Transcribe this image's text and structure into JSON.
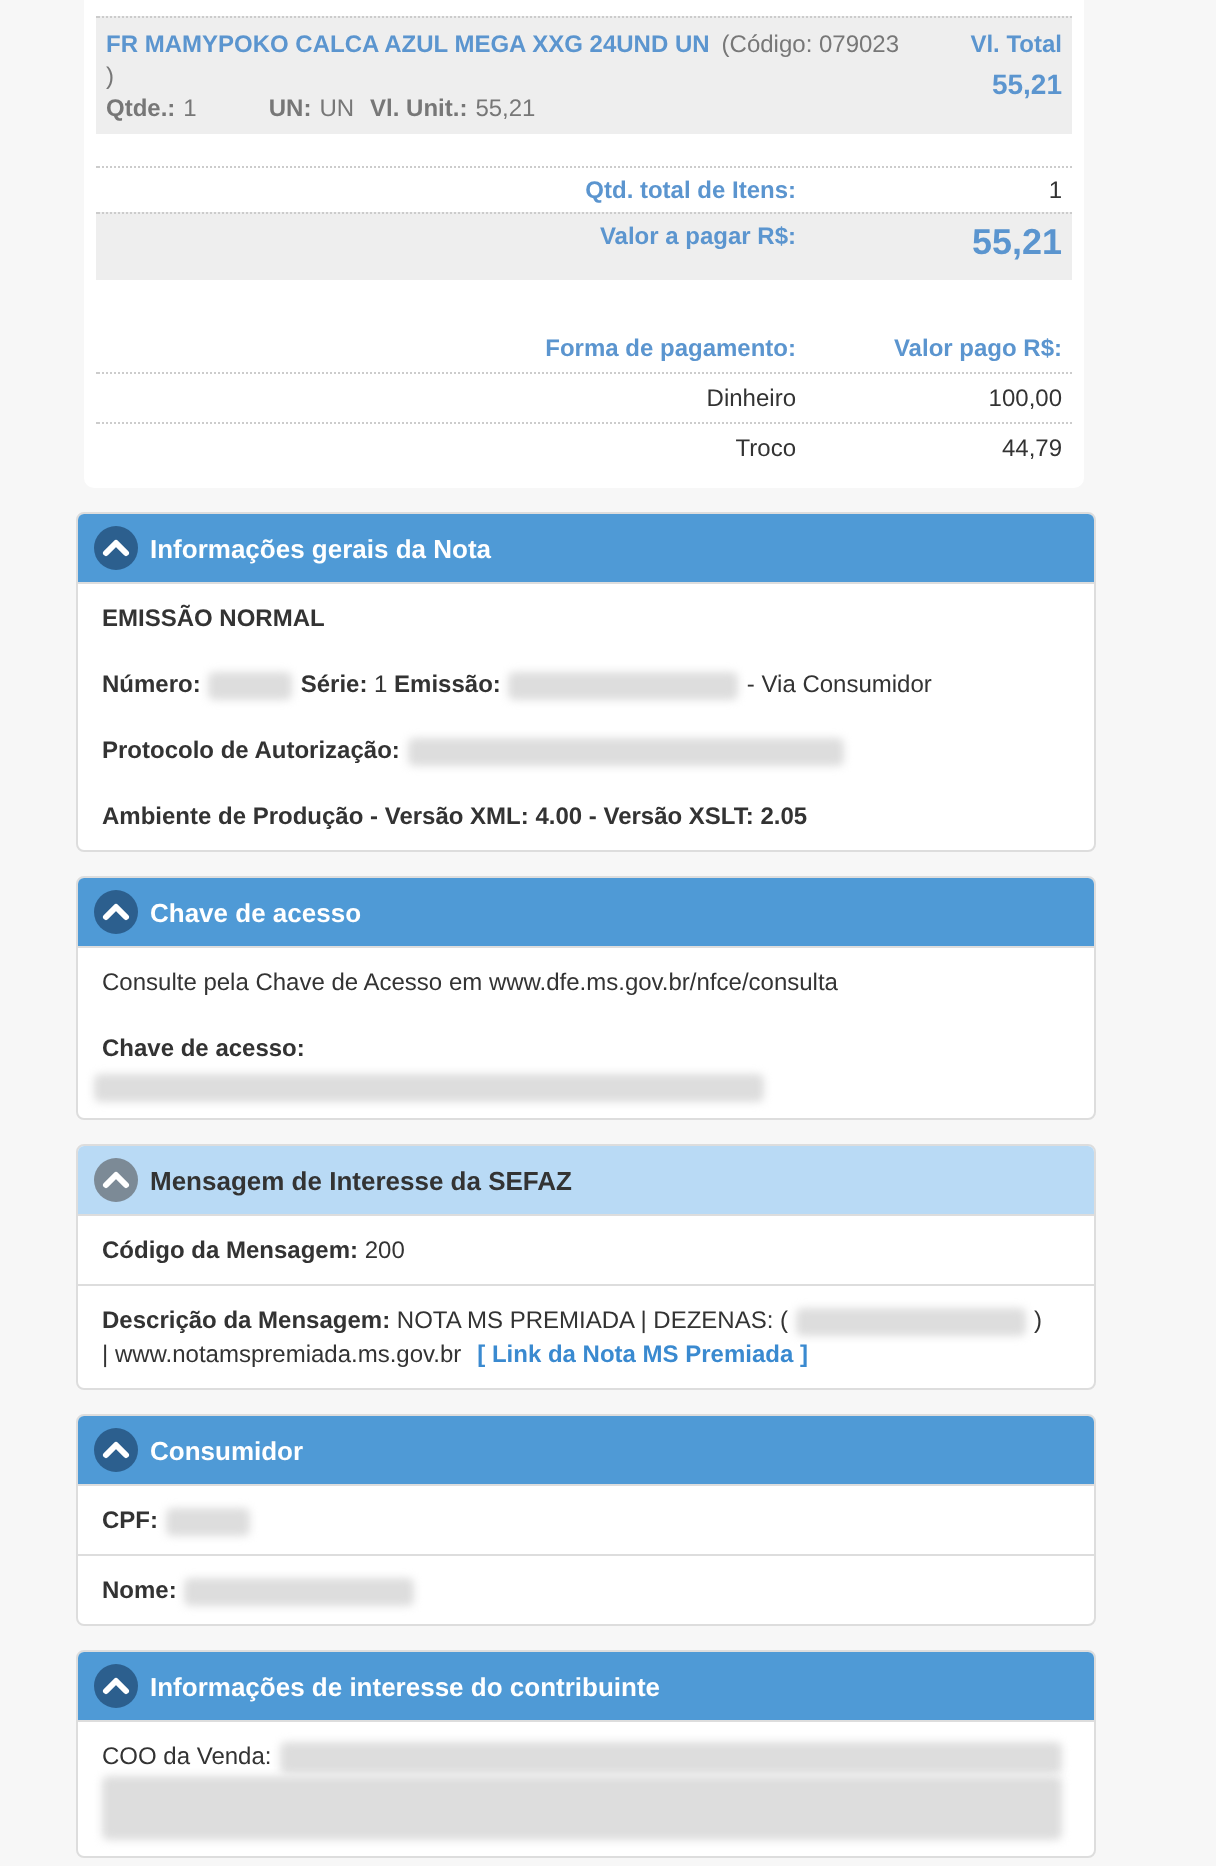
{
  "item": {
    "name": "FR MAMYPOKO CALCA AZUL MEGA XXG 24UND UN",
    "code": [
      "(Código: 079023",
      ")"
    ],
    "qty_label": "Qtde.:",
    "qty": "1",
    "un_label": "UN:",
    "un": "UN",
    "unit_label": "Vl. Unit.:",
    "unit_price": "55,21",
    "total_label": "Vl. Total",
    "total": "55,21"
  },
  "totals": [
    {
      "label": "Qtd. total de Itens:",
      "value": "1",
      "highlighted": false
    },
    {
      "label": "Valor a pagar R$:",
      "value": "55,21",
      "highlighted": true
    }
  ],
  "payments": {
    "header": [
      "Forma de pagamento:",
      "Valor pago R$:"
    ],
    "rows": [
      {
        "method": "Dinheiro",
        "amount": "100,00"
      },
      {
        "method": "Troco",
        "amount": "44,79"
      }
    ]
  },
  "panels": [
    {
      "title": "Informações gerais da Nota",
      "kind": "primary",
      "expanded": true,
      "sections": [
        [
          [
            {
              "kind": "text",
              "text": "**EMISSÃO NORMAL**"
            }
          ],
          [
            {
              "kind": "text",
              "text": "**Número:**"
            },
            {
              "kind": "redacted-short"
            },
            {
              "kind": "text",
              "text": "**Série:** 1 **Emissão:**"
            },
            {
              "kind": "redacted-medium"
            },
            {
              "kind": "text",
              "text": "- Via Consumidor"
            }
          ],
          [
            {
              "kind": "text",
              "text": "**Protocolo de Autorização:**"
            },
            {
              "kind": "redacted-long"
            }
          ],
          [
            {
              "kind": "text",
              "text": "**Ambiente de Produção - Versão XML: 4.00 - Versão XSLT: 2.05**"
            }
          ]
        ]
      ]
    },
    {
      "title": "Chave de acesso",
      "kind": "primary",
      "expanded": true,
      "sections": [
        [
          [
            {
              "kind": "text",
              "text": "Consulte pela Chave de Acesso em www.dfe.ms.gov.br/nfce/consulta"
            }
          ],
          [
            {
              "kind": "text",
              "text": "**Chave de acesso:**"
            },
            {
              "kind": "redacted-line"
            }
          ]
        ]
      ]
    },
    {
      "title": "Mensagem de Interesse da SEFAZ",
      "kind": "light",
      "expanded": true,
      "sections": [
        [
          [
            {
              "kind": "text",
              "text": "**Código da Mensagem:** 200"
            }
          ]
        ],
        [
          [
            {
              "kind": "text",
              "text": "**Descrição da Mensagem:** NOTA MS PREMIADA | DEZENAS: ("
            },
            {
              "kind": "redacted-medium"
            },
            {
              "kind": "text",
              "text": ")"
            },
            {
              "kind": "text",
              "text": "| www.notamspremiada.ms.gov.br"
            },
            {
              "kind": "link",
              "text": "[ Link da Nota MS Premiada ]"
            }
          ]
        ]
      ]
    },
    {
      "title": "Consumidor",
      "kind": "primary",
      "expanded": true,
      "sections": [
        [
          [
            {
              "kind": "text",
              "text": "**CPF:**"
            },
            {
              "kind": "redacted-short"
            }
          ]
        ],
        [
          [
            {
              "kind": "text",
              "text": "**Nome:**"
            },
            {
              "kind": "redacted-medium"
            }
          ]
        ]
      ]
    },
    {
      "title": "Informações de interesse do contribuinte",
      "kind": "primary",
      "expanded": true,
      "sections": [
        [
          [
            {
              "kind": "text",
              "text": "COO da Venda:"
            },
            {
              "kind": "redacted-rest"
            },
            {
              "kind": "redacted-block"
            }
          ]
        ]
      ]
    }
  ]
}
